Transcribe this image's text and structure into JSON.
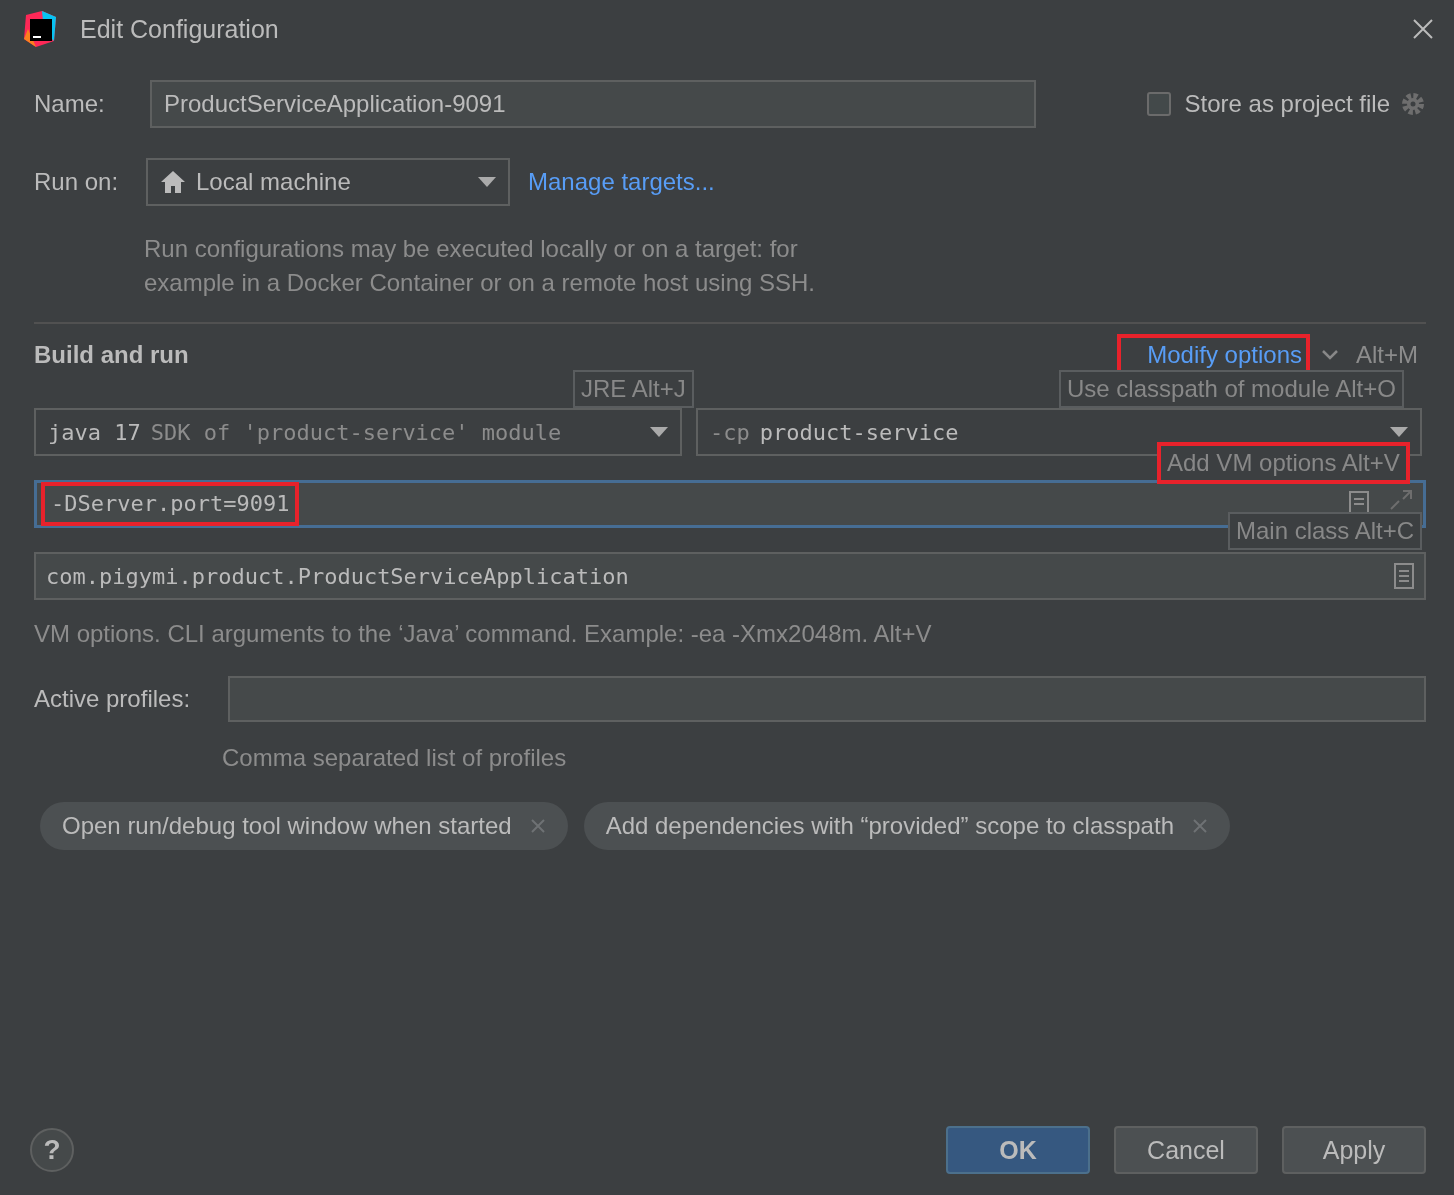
{
  "window": {
    "title": "Edit Configuration"
  },
  "name": {
    "label": "Name:",
    "value": "ProductServiceApplication-9091"
  },
  "store_as_project_file": {
    "label": "Store as project file",
    "checked": false
  },
  "run_on": {
    "label": "Run on:",
    "value": "Local machine",
    "link": "Manage targets..."
  },
  "run_on_help": "Run configurations may be executed locally or on a target: for example in a Docker Container or on a remote host using SSH.",
  "build_and_run": {
    "title": "Build and run",
    "modify_options": "Modify options",
    "modify_highlighted": true,
    "modify_shortcut": "Alt+M",
    "jre": {
      "name": "java 17",
      "detail": "SDK of 'product-service' module"
    },
    "classpath": {
      "flag": "-cp",
      "module": "product-service"
    },
    "vm_options": {
      "value": "-DServer.port=9091",
      "focused": true,
      "highlighted": true
    },
    "main_class": {
      "value": "com.pigymi.product.ProductServiceApplication"
    },
    "hints": [
      {
        "kind": "jre",
        "text": "JRE Alt+J",
        "highlighted": false
      },
      {
        "kind": "classpath",
        "text": "Use classpath of module Alt+O",
        "highlighted": false
      },
      {
        "kind": "vm_options",
        "text": "Add VM options Alt+V",
        "highlighted": true
      },
      {
        "kind": "main_class",
        "text": "Main class Alt+C",
        "highlighted": false
      }
    ]
  },
  "vm_help": "VM options. CLI arguments to the ‘Java’ command. Example: -ea -Xmx2048m. Alt+V",
  "active_profiles": {
    "label": "Active profiles:",
    "help": "Comma separated list of profiles"
  },
  "options": [
    {
      "label": "Open run/debug tool window when started"
    },
    {
      "label": "Add dependencies with “provided” scope to classpath"
    }
  ],
  "help_button": "?",
  "buttons": [
    {
      "label": "OK",
      "default": true
    },
    {
      "label": "Cancel",
      "default": false
    },
    {
      "label": "Apply",
      "default": false
    }
  ]
}
